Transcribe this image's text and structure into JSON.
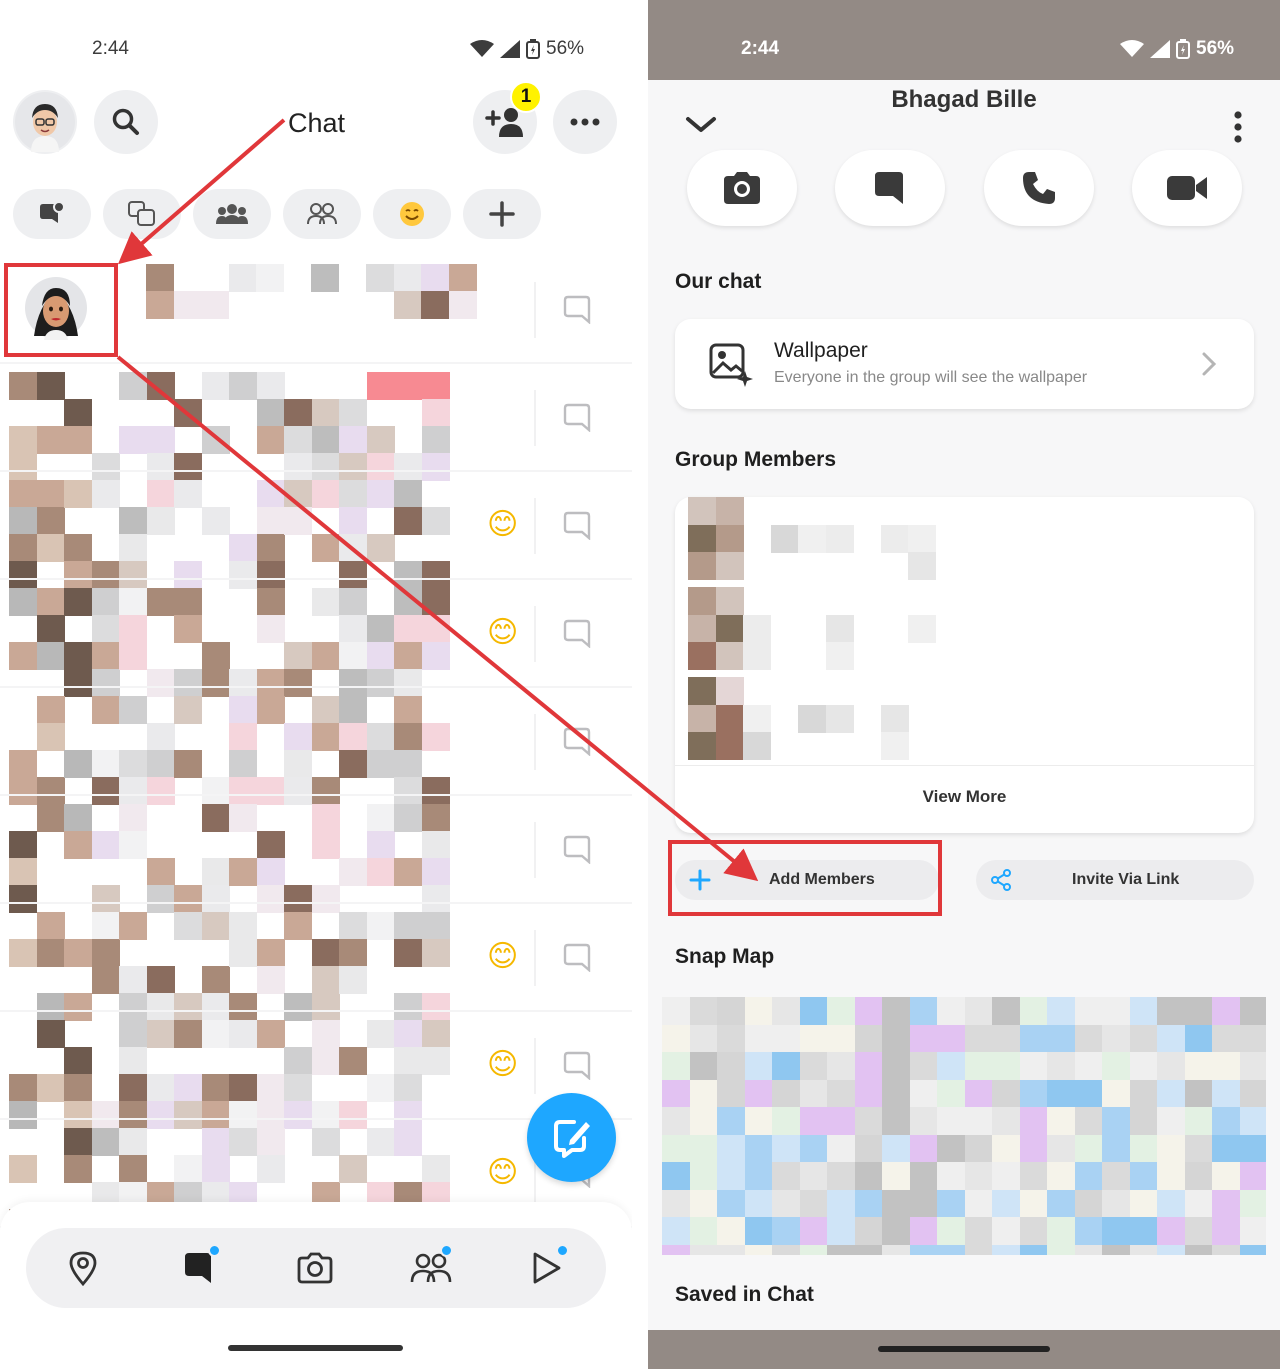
{
  "left": {
    "status": {
      "time": "2:44",
      "battery": "56%"
    },
    "header": {
      "avatar_icon": "bitmoji-avatar-icon",
      "search_icon": "search-icon",
      "add_friend_badge": "1",
      "more_icon": "more-dots-icon"
    },
    "filters": [
      {
        "icon": "unread-chat-icon"
      },
      {
        "icon": "stories-chat-icon"
      },
      {
        "icon": "groups-icon"
      },
      {
        "icon": "friends-icon"
      },
      {
        "icon": "emoji-smile-icon"
      },
      {
        "icon": "plus-icon"
      }
    ],
    "chat_rows": [
      {
        "emoji": ""
      },
      {
        "emoji": ""
      },
      {
        "emoji": "😊"
      },
      {
        "emoji": "😊"
      },
      {
        "emoji": ""
      },
      {
        "emoji": ""
      },
      {
        "emoji": "😊"
      },
      {
        "emoji": "😊"
      },
      {
        "emoji": "😊"
      }
    ],
    "nav": [
      {
        "icon": "map-pin-icon"
      },
      {
        "icon": "chat-icon"
      },
      {
        "icon": "camera-icon"
      },
      {
        "icon": "friends-icon"
      },
      {
        "icon": "spotlight-play-icon"
      }
    ]
  },
  "annotation": {
    "chat_label": "Chat"
  },
  "right": {
    "status": {
      "time": "2:44",
      "battery": "56%"
    },
    "group_name": "Bhagad Bille",
    "actions": [
      {
        "icon": "camera-icon"
      },
      {
        "icon": "chat-bubble-icon"
      },
      {
        "icon": "phone-icon"
      },
      {
        "icon": "video-icon"
      }
    ],
    "our_chat": {
      "heading": "Our chat",
      "wallpaper_title": "Wallpaper",
      "wallpaper_sub": "Everyone in the group will see the wallpaper"
    },
    "group_members": {
      "heading": "Group Members",
      "view_more": "View More",
      "add_members": "Add Members",
      "invite_link": "Invite Via Link"
    },
    "snap_map": {
      "heading": "Snap Map"
    },
    "saved": {
      "heading": "Saved in Chat"
    }
  }
}
